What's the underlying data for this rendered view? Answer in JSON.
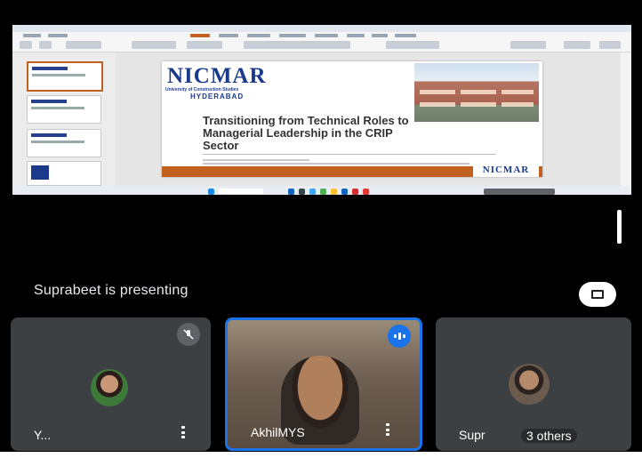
{
  "presentation": {
    "logo": "NICMAR",
    "university": "University of Construction Studies",
    "city": "HYDERABAD",
    "slide_title": "Transitioning from Technical Roles to Managerial Leadership in the CRIP Sector",
    "footer_logo": "NICMAR"
  },
  "stage": {
    "presenting_text": "Suprabeet is presenting",
    "fullscreen_icon": "fullscreen-icon"
  },
  "participants": [
    {
      "name": "Y...",
      "muted": true
    },
    {
      "name": "AkhilMYS",
      "speaking": true
    },
    {
      "name": "Supr",
      "overlay": "3 others"
    }
  ],
  "colors": {
    "accent": "#1a73e8",
    "tile_bg": "#3c4043",
    "nicmar_blue": "#1b3a8c",
    "nicmar_orange": "#c2611f"
  }
}
